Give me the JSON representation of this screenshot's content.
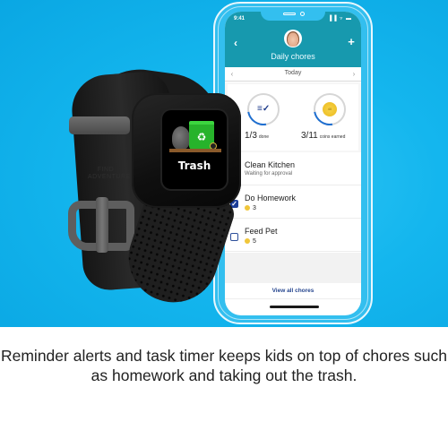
{
  "colors": {
    "background_blue": "#14b6ee",
    "app_header": "#1799ae",
    "accent_navy": "#1e3f98",
    "coin_gold": "#f0c63a",
    "progress_blue": "#1f6fd0"
  },
  "watch": {
    "band_emboss": "FIND ADVENTURE",
    "screen_label": "Trash",
    "screen_icons": [
      "trash-bag-icon",
      "recycle-bin-icon",
      "star-badge-icon"
    ]
  },
  "phone": {
    "status_bar": {
      "time": "9:41",
      "icons": [
        "signal-icon",
        "wifi-icon",
        "battery-icon"
      ],
      "icon_glyphs": "▐▐ ▿ ▬"
    },
    "header": {
      "back_glyph": "‹",
      "add_glyph": "+",
      "title": "Daily chores"
    },
    "date_nav": {
      "prev_glyph": "‹",
      "label": "Today",
      "next_glyph": "›"
    },
    "stats": [
      {
        "value": "1/3",
        "label": "done",
        "icon": "tasks-check-icon",
        "icon_glyph": "≡✓",
        "progress": 0.33
      },
      {
        "value": "3/11",
        "label": "coins earned",
        "icon": "coin-icon",
        "icon_glyph": "40",
        "progress": 0.27
      }
    ],
    "chores": [
      {
        "title": "Clean Kitchen",
        "subtitle": "Waiting for approval",
        "checked": false,
        "coins": null
      },
      {
        "title": "Do Homework",
        "subtitle": null,
        "checked": true,
        "coins": "3"
      },
      {
        "title": "Feed Pet",
        "subtitle": null,
        "checked": false,
        "coins": "5"
      }
    ],
    "check_glyph": "✓",
    "view_all_label": "View all chores"
  },
  "caption": "Reminder alerts and task timer keeps kids on top of chores such as homework and taking out the trash."
}
